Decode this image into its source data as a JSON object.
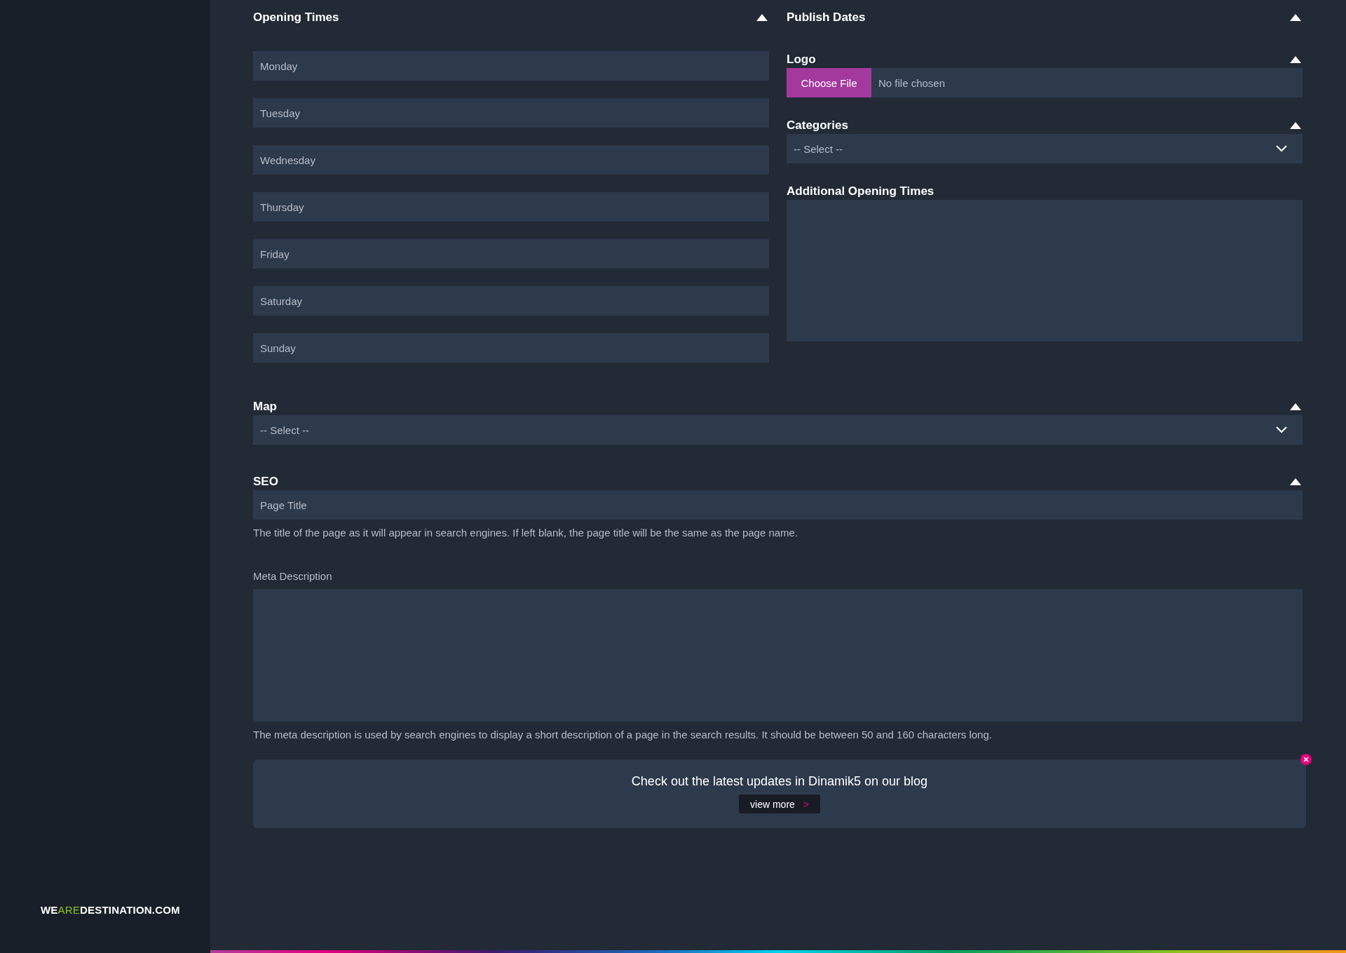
{
  "sidebar": {
    "brand": [
      {
        "text": "WE",
        "accent": false
      },
      {
        "text": "ARE",
        "accent": true
      },
      {
        "text": "DESTINATION.COM",
        "accent": false
      }
    ]
  },
  "opening_times": {
    "title": "Opening Times",
    "expanded": true,
    "fields": [
      {
        "placeholder": "Monday"
      },
      {
        "placeholder": "Tuesday"
      },
      {
        "placeholder": "Wednesday"
      },
      {
        "placeholder": "Thursday"
      },
      {
        "placeholder": "Friday"
      },
      {
        "placeholder": "Saturday"
      },
      {
        "placeholder": "Sunday"
      }
    ]
  },
  "publish_dates": {
    "title": "Publish Dates",
    "expanded": true
  },
  "logo": {
    "title": "Logo",
    "expanded": true,
    "button": "Choose File",
    "status": "No file chosen"
  },
  "categories": {
    "title": "Categories",
    "expanded": true,
    "value": "-- Select --"
  },
  "additional_opening_times": {
    "title": "Additional Opening Times"
  },
  "map": {
    "title": "Map",
    "expanded": true,
    "value": "-- Select --"
  },
  "seo": {
    "title": "SEO",
    "expanded": true,
    "page_title": {
      "placeholder": "Page Title",
      "help": "The title of the page as it will appear in search engines. If left blank, the page title will be the same as the page name."
    },
    "meta_description": {
      "label": "Meta Description",
      "help": "The meta description is used by search engines to display a short description of a page in the search results. It should be between 50 and 160 characters long."
    }
  },
  "banner": {
    "message": "Check out the latest updates in Dinamik5 on our blog",
    "button": "view more",
    "button_icon": ">"
  }
}
